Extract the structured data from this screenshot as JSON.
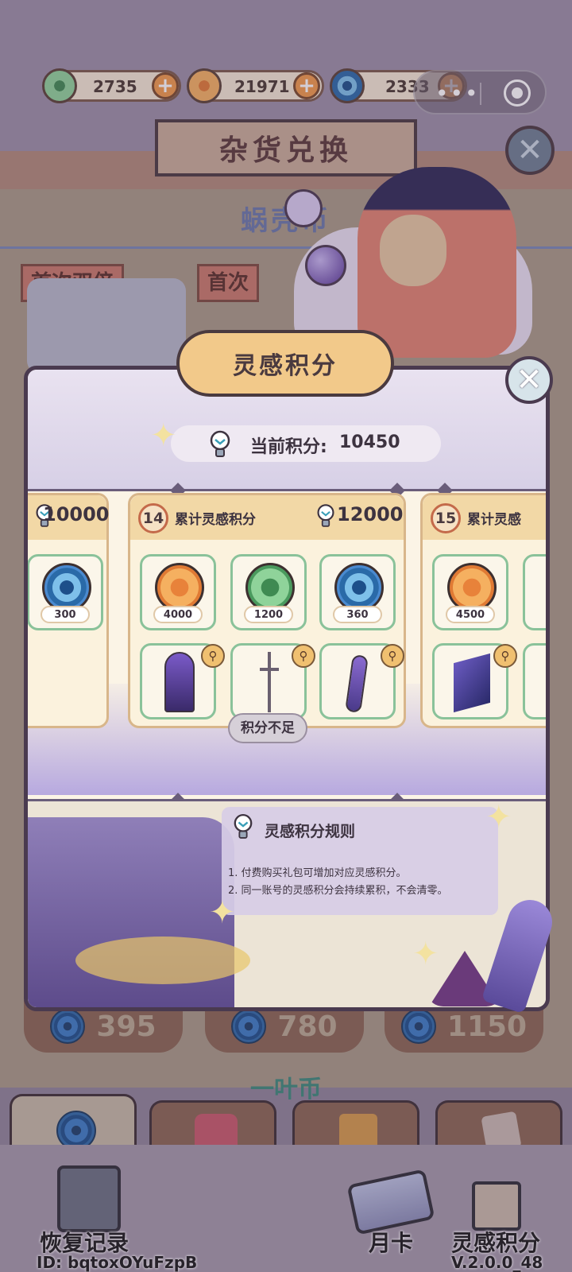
{
  "currencies": [
    {
      "name": "clover",
      "value": "2735",
      "color": "#8fd39a"
    },
    {
      "name": "shell",
      "value": "21971",
      "color": "#f5b060"
    },
    {
      "name": "swirl",
      "value": "2333",
      "color": "#4a8ad0"
    }
  ],
  "plus_symbol": "+",
  "mini_program": {
    "dots": "•••"
  },
  "banner": {
    "title": "杂货兑换",
    "close": "✕"
  },
  "background": {
    "shop_title": "蜗壳币",
    "tags": [
      "首次双倍",
      "首次"
    ],
    "prices": [
      "395",
      "780",
      "1150"
    ],
    "sub_title": "一叶币"
  },
  "modal": {
    "title": "灵感积分",
    "close": "✕",
    "current_label": "当前积分:",
    "current_value": "10450",
    "insufficient": "积分不足",
    "tiers": [
      {
        "num": "",
        "title": "",
        "required": "10000",
        "rewards": [
          {
            "coin": "blue",
            "qty": "300"
          }
        ]
      },
      {
        "num": "14",
        "title": "累计灵感积分",
        "required": "12000",
        "rewards": [
          {
            "coin": "orange",
            "qty": "4000"
          },
          {
            "coin": "green",
            "qty": "1200"
          },
          {
            "coin": "blue",
            "qty": "360"
          }
        ]
      },
      {
        "num": "15",
        "title": "累计灵感",
        "required": "",
        "rewards": [
          {
            "coin": "orange",
            "qty": "4500"
          }
        ]
      }
    ],
    "zoom_icon": "⚲",
    "rules": {
      "title": "灵感积分规则",
      "lines": [
        "1. 付费购买礼包可增加对应灵感积分。",
        "2. 同一账号的灵感积分会持续累积，不会清零。"
      ]
    }
  },
  "bottom": {
    "records": "恢复记录",
    "id": "ID: bqtoxOYuFzpB",
    "monthly": "月卡",
    "points": "灵感积分",
    "version": "V.2.0.0_48"
  }
}
